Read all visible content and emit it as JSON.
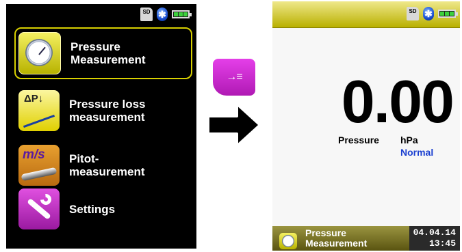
{
  "menu": {
    "items": [
      {
        "label": "Pressure\nMeasurement",
        "icon": "pressure-gauge-icon",
        "selected": true
      },
      {
        "label": "Pressure loss\nmeasurement",
        "icon": "pressure-loss-icon",
        "icon_text": "ΔP↓",
        "selected": false
      },
      {
        "label": "Pitot-\nmeasurement",
        "icon": "pitot-tube-icon",
        "icon_text": "m/s",
        "selected": false
      },
      {
        "label": "Settings",
        "icon": "wrench-icon",
        "selected": false
      }
    ]
  },
  "status": {
    "sd_label": "SD",
    "bluetooth_symbol": "✱",
    "battery_bars": 3
  },
  "key_button": {
    "icon": "enter-key-icon",
    "glyph": "→≡"
  },
  "transition_arrow": {
    "icon": "right-arrow-icon"
  },
  "measurement": {
    "value": "0.00",
    "quantity": "Pressure",
    "unit": "hPa",
    "mode": "Normal"
  },
  "footer": {
    "program_label": "Pressure\nMeasurement",
    "date": "04.04.14",
    "time": "13:45"
  },
  "colors": {
    "selection_border": "#d8d000",
    "mode_text": "#1a3fd0",
    "key_button": "#d030d4",
    "topbar": "#d8d060"
  }
}
